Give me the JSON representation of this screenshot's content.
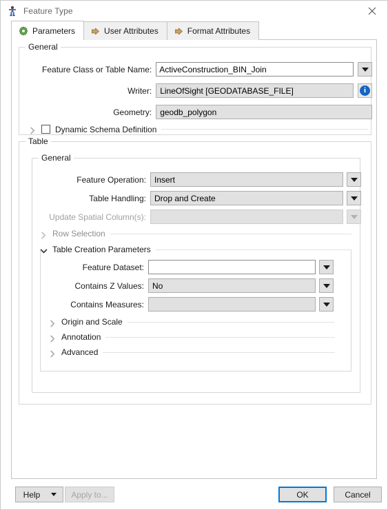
{
  "window": {
    "title": "Feature Type",
    "icon": "fme-feature-type-icon",
    "close_label": "close-icon"
  },
  "tabs": [
    {
      "label": "Parameters",
      "icon": "gear-icon",
      "active": true
    },
    {
      "label": "User Attributes",
      "icon": "arrow-right-icon",
      "active": false
    },
    {
      "label": "Format Attributes",
      "icon": "arrow-right-icon",
      "active": false
    }
  ],
  "general": {
    "legend": "General",
    "feature_class_label": "Feature Class or Table Name:",
    "feature_class_value": "ActiveConstruction_BIN_Join",
    "writer_label": "Writer:",
    "writer_value": "LineOfSight [GEODATABASE_FILE]",
    "geometry_label": "Geometry:",
    "geometry_value": "geodb_polygon",
    "dynamic_schema_label": "Dynamic Schema Definition",
    "dynamic_schema_checked": false
  },
  "table": {
    "legend": "Table",
    "general": {
      "legend": "General",
      "feature_operation_label": "Feature Operation:",
      "feature_operation_value": "Insert",
      "table_handling_label": "Table Handling:",
      "table_handling_value": "Drop and Create",
      "update_spatial_label": "Update Spatial Column(s):",
      "update_spatial_value": "",
      "row_selection_label": "Row Selection",
      "table_creation_label": "Table Creation Parameters",
      "feature_dataset_label": "Feature Dataset:",
      "feature_dataset_value": "",
      "contains_z_label": "Contains Z Values:",
      "contains_z_value": "No",
      "contains_measures_label": "Contains Measures:",
      "contains_measures_value": "",
      "origin_scale_label": "Origin and Scale",
      "annotation_label": "Annotation",
      "advanced_label": "Advanced"
    }
  },
  "footer": {
    "help_label": "Help",
    "apply_to_label": "Apply to...",
    "ok_label": "OK",
    "cancel_label": "Cancel"
  },
  "colors": {
    "accent": "#0078d7",
    "info_badge": "#1565c0",
    "tab_icon_gear": "#5a9e3f",
    "tab_icon_arrow": "#c69a5e"
  }
}
